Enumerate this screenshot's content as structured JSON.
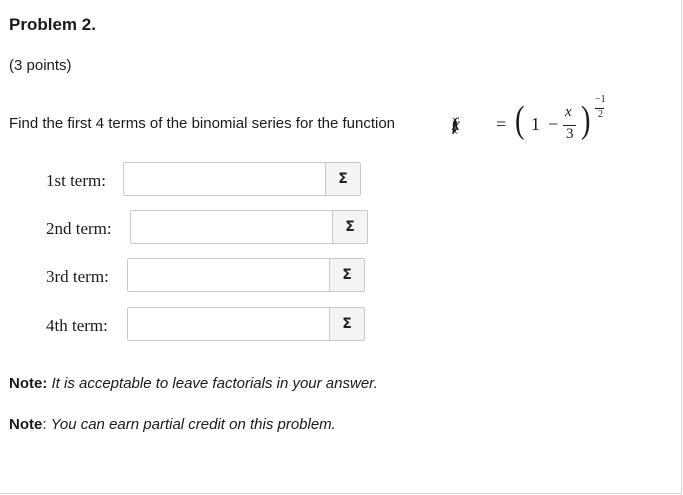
{
  "problem": {
    "title": "Problem 2.",
    "points": "(3 points)",
    "statement": "Find the first 4 terms of the binomial series for the function",
    "formula": {
      "lhs_func": "f",
      "lhs_open": "(",
      "lhs_var": "x",
      "lhs_close": ")",
      "equals": "=",
      "left_paren": "(",
      "one": "1",
      "minus": "−",
      "frac_num": "x",
      "frac_den": "3",
      "right_paren": ")",
      "exp_num": "−1",
      "exp_den": "2"
    }
  },
  "answers": [
    {
      "label": "1st term:",
      "value": ""
    },
    {
      "label": "2nd term:",
      "value": ""
    },
    {
      "label": "3rd term:",
      "value": ""
    },
    {
      "label": "4th term:",
      "value": ""
    }
  ],
  "equation_button_symbol": "Σ",
  "notes": [
    {
      "prefix": "Note:",
      "text": "It is acceptable to leave factorials in your answer."
    },
    {
      "prefix": "Note",
      "colon": ":",
      "text": "You can earn partial credit on this problem."
    }
  ]
}
